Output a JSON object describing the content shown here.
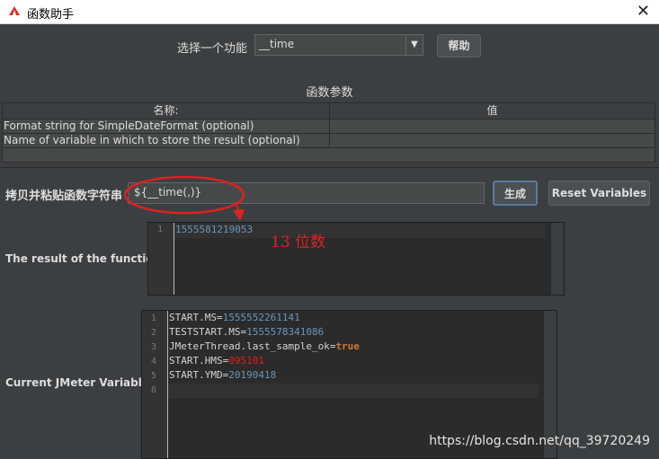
{
  "window": {
    "title": "函数助手",
    "close_symbol": "✕"
  },
  "function_select": {
    "label": "选择一个功能",
    "value": "__time",
    "arrow": "▼"
  },
  "help_button": {
    "label": "帮助"
  },
  "params": {
    "title": "函数参数",
    "columns": [
      "名称:",
      "值"
    ],
    "rows": [
      {
        "name": "Format string for SimpleDateFormat (optional)",
        "value": ""
      },
      {
        "name": "Name of variable in which to store the result (optional)",
        "value": ""
      }
    ]
  },
  "copy": {
    "label": "拷贝并粘贴函数字符串",
    "value": "${__time(,)}"
  },
  "generate_button": {
    "label": "生成"
  },
  "reset_button": {
    "label": "Reset Variables"
  },
  "result": {
    "label": "The result of the function is",
    "lines": [
      {
        "num": "1",
        "text": "1555581219053"
      }
    ]
  },
  "vars": {
    "label": "Current JMeter Variables",
    "lines": [
      {
        "num": "1",
        "key": "START.MS",
        "value": "1555552261141"
      },
      {
        "num": "2",
        "key": "TESTSTART.MS",
        "value": "1555578341086"
      },
      {
        "num": "3",
        "key": "JMeterThread.last_sample_ok",
        "value": "true"
      },
      {
        "num": "4",
        "key": "START.HMS",
        "value": "095101"
      },
      {
        "num": "5",
        "key": "START.YMD",
        "value": "20190418"
      },
      {
        "num": "6",
        "key": "",
        "value": ""
      }
    ]
  },
  "annotation": {
    "text": "13 位数",
    "color": "#e02020"
  },
  "watermark": "https://blog.csdn.net/qq_39720249",
  "colors": {
    "background": "#3c3f41",
    "editor": "#2b2b2b",
    "number": "#6897bb",
    "keyword": "#cc7832"
  }
}
